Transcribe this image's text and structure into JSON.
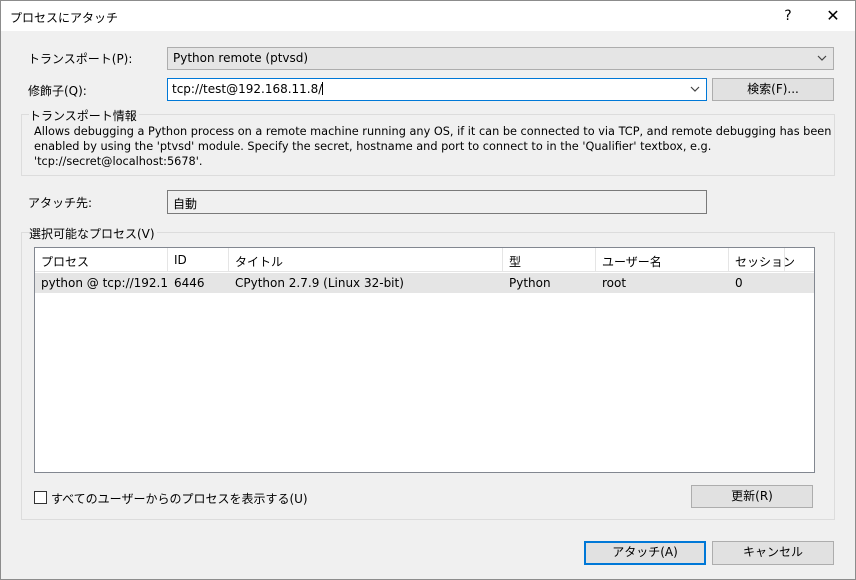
{
  "window": {
    "title": "プロセスにアタッチ",
    "help_label": "?",
    "close_label": "✕"
  },
  "transport": {
    "label": "トランスポート(P):",
    "value": "Python remote (ptvsd)"
  },
  "qualifier": {
    "label": "修飾子(Q):",
    "value": "tcp://test@192.168.11.8/",
    "search_button": "検索(F)..."
  },
  "transport_info": {
    "title": "トランスポート情報",
    "line1": "Allows debugging a Python process on a remote machine running any OS, if it can be connected to via TCP, and remote debugging has been",
    "line2": "enabled by using the 'ptvsd' module. Specify the secret, hostname and port to connect to in the 'Qualifier' textbox, e.g.",
    "line3": "'tcp://secret@localhost:5678'."
  },
  "attach_to": {
    "label": "アタッチ先:",
    "value": "自動"
  },
  "processes": {
    "title": "選択可能なプロセス(V)",
    "columns": [
      "プロセス",
      "ID",
      "タイトル",
      "型",
      "ユーザー名",
      "セッション"
    ],
    "rows": [
      [
        "python @ tcp://192.1...",
        "6446",
        "CPython 2.7.9 (Linux 32-bit)",
        "Python",
        "root",
        "0"
      ]
    ],
    "show_all_users_label": "すべてのユーザーからのプロセスを表示する(U)",
    "show_all_users_checked": false,
    "refresh_button": "更新(R)"
  },
  "footer": {
    "attach_button": "アタッチ(A)",
    "cancel_button": "キャンセル"
  },
  "colors": {
    "accent": "#0078d7",
    "background": "#f0f0f0"
  }
}
